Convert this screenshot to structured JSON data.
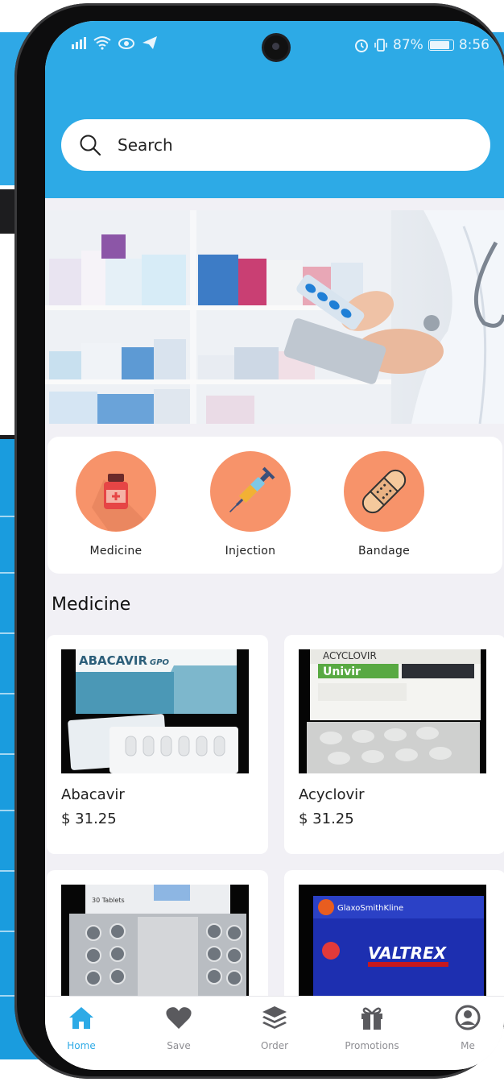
{
  "status_bar": {
    "battery_percent": "87%",
    "time": "8:56"
  },
  "search": {
    "placeholder": "Search"
  },
  "categories": [
    {
      "label": "Medicine",
      "icon": "medicine-bottle-icon"
    },
    {
      "label": "Injection",
      "icon": "syringe-icon"
    },
    {
      "label": "Bandage",
      "icon": "bandage-icon"
    }
  ],
  "section": {
    "title": "Medicine"
  },
  "products": [
    {
      "name": "Abacavir",
      "price": "$ 31.25",
      "box_text": "ABACAVIR",
      "box_sub": "GPO"
    },
    {
      "name": "Acyclovir",
      "price": "$ 31.25",
      "box_text": "ACYCLOVIR",
      "box_sub": "Univir"
    },
    {
      "name": "",
      "price": "",
      "box_text": "30 Tablets",
      "box_sub": ""
    },
    {
      "name": "",
      "price": "",
      "box_text": "VALTREX",
      "box_sub": "GlaxoSmithKline"
    }
  ],
  "nav": {
    "items": [
      {
        "label": "Home",
        "icon": "home-icon",
        "active": true
      },
      {
        "label": "Save",
        "icon": "heart-icon",
        "active": false
      },
      {
        "label": "Order",
        "icon": "layers-icon",
        "active": false
      },
      {
        "label": "Promotions",
        "icon": "gift-icon",
        "active": false
      },
      {
        "label": "Me",
        "icon": "user-icon",
        "active": false
      }
    ]
  },
  "colors": {
    "primary": "#2daae6",
    "category_circle": "#f7936a",
    "background": "#f1f0f5"
  }
}
